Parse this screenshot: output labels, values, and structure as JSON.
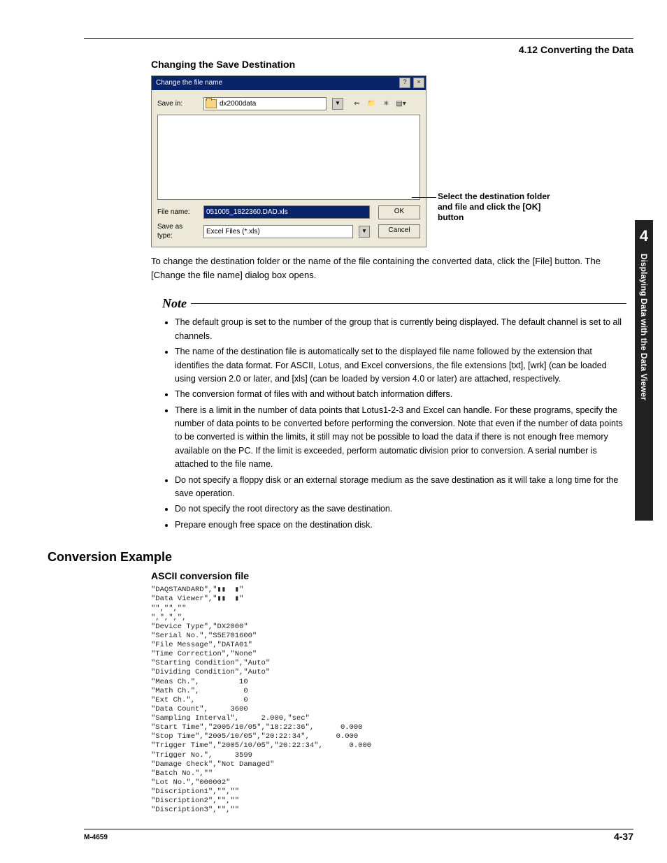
{
  "header": {
    "section_number": "4.12  Converting the Data"
  },
  "changing": {
    "heading": "Changing the Save Destination",
    "dialog": {
      "title": "Change the file name",
      "save_in_label": "Save in:",
      "save_in_folder": "dx2000data",
      "file_name_label": "File name:",
      "file_name_value": "051005_1822360.DAD.xls",
      "save_as_type_label": "Save as type:",
      "save_as_type_value": "Excel Files (*.xls)",
      "ok_label": "OK",
      "cancel_label": "Cancel"
    },
    "callout": "Select the destination folder and file and click the [OK] button",
    "body": "To change the destination folder or the name of the file containing the converted data, click the [File] button.  The [Change the file name] dialog box opens."
  },
  "note": {
    "label": "Note",
    "items": [
      "The default group is set to the number of the group that is currently being displayed.  The default channel is set to all channels.",
      "The name of the destination file is automatically set to the displayed file name followed by the extension that identifies the data format.  For ASCII, Lotus, and Excel conversions, the file extensions [txt], [wrk] (can be loaded using version 2.0 or later, and [xls] (can be loaded by version 4.0 or later) are attached, respectively.",
      "The conversion format of files with and without batch information differs.",
      "There is a limit in the number of data points that Lotus1-2-3 and Excel can handle.  For these programs, specify the number of data points to be converted before performing the conversion.  Note that even if the number of data points to be converted is within the limits, it still may not be possible to load the data if there is not enough free memory available on the PC.  If the limit is exceeded, perform automatic division prior to conversion. A serial number is attached to the file name.",
      "Do not specify a floppy disk or an external storage medium as the save destination as it will take a long time for the save operation.",
      "Do not specify the root directory as the save destination.",
      "Prepare enough free space on the destination disk."
    ]
  },
  "conversion": {
    "heading": "Conversion Example",
    "ascii_heading": "ASCII conversion file",
    "ascii_body": "\"DAQSTANDARD\",\"▮▮  ▮\"\n\"Data Viewer\",\"▮▮  ▮\"\n\"\",\"\",\"\"\n\",\",\",\",\n\"Device Type\",\"DX2000\"\n\"Serial No.\",\"S5E701600\"\n\"File Message\",\"DATA01\"\n\"Time Correction\",\"None\"\n\"Starting Condition\",\"Auto\"\n\"Dividing Condition\",\"Auto\"\n\"Meas Ch.\",         10\n\"Math Ch.\",          0\n\"Ext Ch.\",           0\n\"Data Count\",     3600\n\"Sampling Interval\",     2.000,\"sec\"\n\"Start Time\",\"2005/10/05\",\"18:22:36\",      0.000\n\"Stop Time\",\"2005/10/05\",\"20:22:34\",      0.000\n\"Trigger Time\",\"2005/10/05\",\"20:22:34\",      0.000\n\"Trigger No.\",     3599\n\"Damage Check\",\"Not Damaged\"\n\"Batch No.\",\"\"\n\"Lot No.\",\"000002\"\n\"Discription1\",\"\",\"\"\n\"Discription2\",\"\",\"\"\n\"Discription3\",\"\",\"\""
  },
  "sidebar": {
    "chapter": "4",
    "title": "Displaying Data with the Data Viewer"
  },
  "footer": {
    "left": "M-4659",
    "right": "4-37"
  }
}
